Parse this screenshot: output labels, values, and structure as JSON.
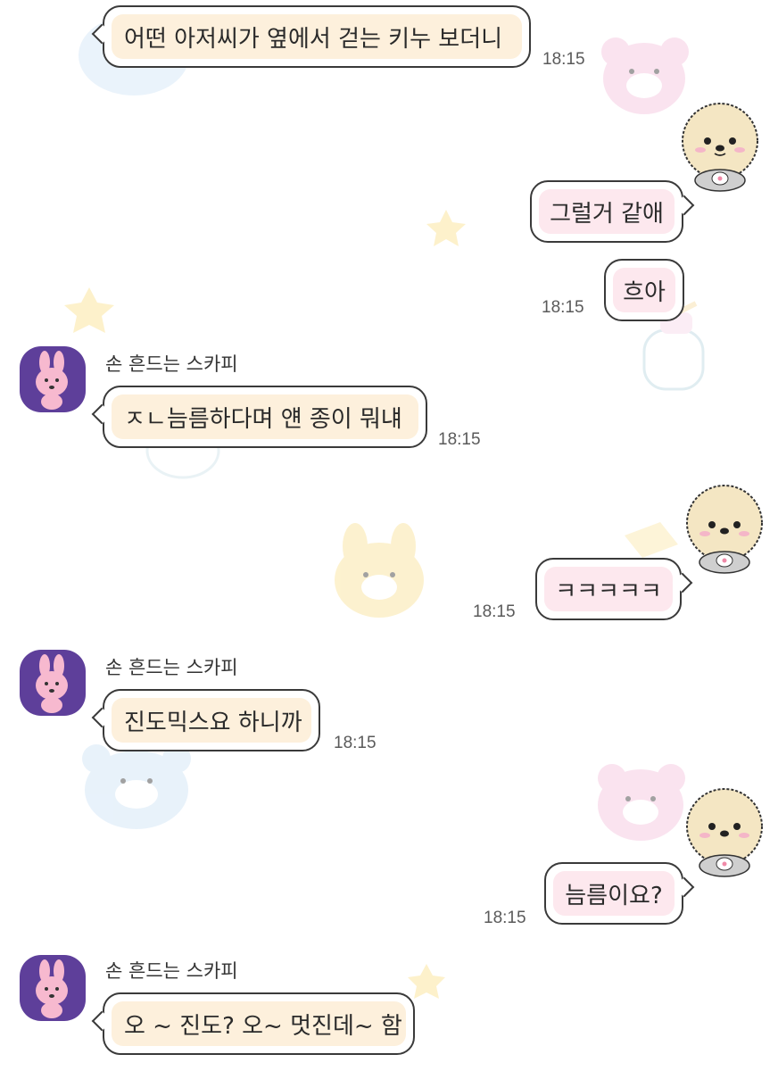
{
  "chat": {
    "messages": [
      {
        "direction": "incoming",
        "text": "어떤 아저씨가 옆에서 걷는 키누 보더니",
        "time": "18:15"
      },
      {
        "direction": "outgoing",
        "text": "그럴거 같애"
      },
      {
        "direction": "outgoing",
        "text": "흐아",
        "time": "18:15"
      },
      {
        "direction": "incoming",
        "sender": "손 흔드는 스카피",
        "text": "ㅈㄴ늠름하다며 얜 종이 뭐냬",
        "time": "18:15"
      },
      {
        "direction": "outgoing",
        "text": "ㅋㅋㅋㅋㅋ",
        "time": "18:15"
      },
      {
        "direction": "incoming",
        "sender": "손 흔드는 스카피",
        "text": "진도믹스요 하니까",
        "time": "18:15"
      },
      {
        "direction": "outgoing",
        "text": "늠름이요?",
        "time": "18:15"
      },
      {
        "direction": "incoming",
        "sender": "손 흔드는 스카피",
        "text": "오 ~ 진도? 오~ 멋진데~ 함"
      }
    ]
  },
  "icons": {
    "contact_avatar": "pink-rabbit-icon",
    "my_avatar": "hedgehog-icon",
    "background": [
      "bear-sticker",
      "star-sticker",
      "bottle-sticker",
      "bunny-sticker"
    ]
  },
  "colors": {
    "incoming_fill": "#fdf0dc",
    "outgoing_fill": "#fde8ee",
    "avatar_bg": "#5e3f9a",
    "border": "#3a3a3a"
  }
}
